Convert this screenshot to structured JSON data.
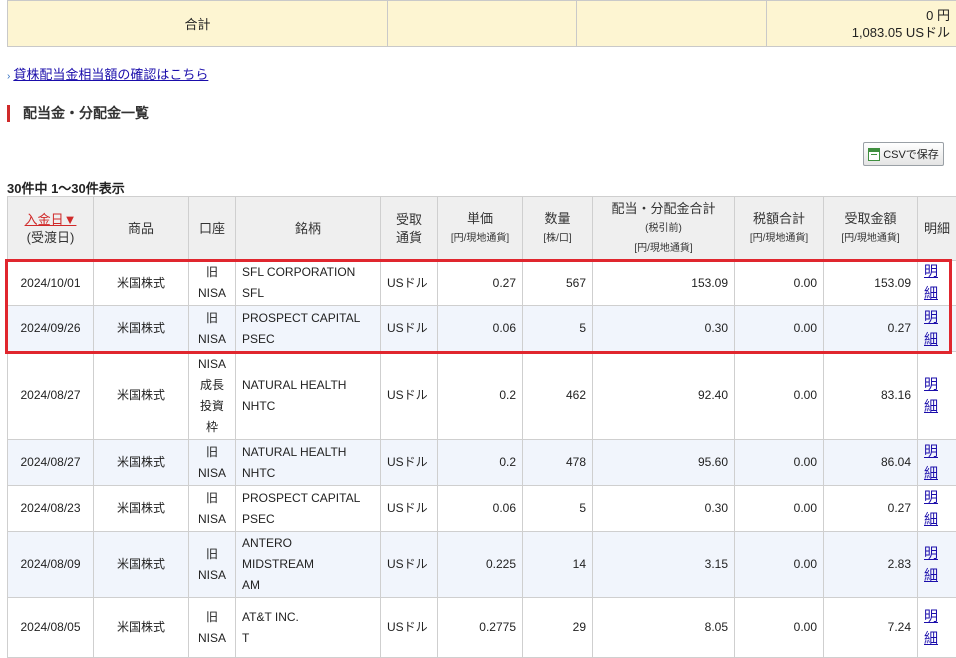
{
  "summary": {
    "total_label": "合計",
    "total_jpy": "0 円",
    "total_usd": "1,083.05 USドル"
  },
  "links": {
    "lending_dividend": "貸株配当金相当額の確認はこちら"
  },
  "section": {
    "title": "配当金・分配金一覧"
  },
  "toolbar": {
    "csv_label": "CSVで保存"
  },
  "list": {
    "count_label": "30件中 1～30件表示"
  },
  "table": {
    "headers": {
      "date": "入金日▼",
      "date_sub": "(受渡日)",
      "product": "商品",
      "account": "口座",
      "security": "銘柄",
      "currency_1": "受取",
      "currency_2": "通貨",
      "unit_price": "単価",
      "unit_price_sub": "[円/現地通貨]",
      "quantity": "数量",
      "quantity_sub": "[株/口]",
      "dividend_total": "配当・分配金合計",
      "dividend_total_sub1": "(税引前)",
      "dividend_total_sub2": "[円/現地通貨]",
      "tax_total": "税額合計",
      "tax_total_sub": "[円/現地通貨]",
      "received": "受取金額",
      "received_sub": "[円/現地通貨]",
      "detail": "明細"
    },
    "rows": [
      {
        "date": "2024/10/01",
        "product": "米国株式",
        "account": [
          "旧",
          "NISA"
        ],
        "security": [
          "SFL CORPORATION",
          "SFL"
        ],
        "currency": "USドル",
        "unit_price": "0.27",
        "quantity": "567",
        "dividend": "153.09",
        "tax": "0.00",
        "received": "153.09",
        "detail": "明細"
      },
      {
        "date": "2024/09/26",
        "product": "米国株式",
        "account": [
          "旧",
          "NISA"
        ],
        "security": [
          "PROSPECT CAPITAL",
          "PSEC"
        ],
        "currency": "USドル",
        "unit_price": "0.06",
        "quantity": "5",
        "dividend": "0.30",
        "tax": "0.00",
        "received": "0.27",
        "detail": "明細"
      },
      {
        "date": "2024/08/27",
        "product": "米国株式",
        "account": [
          "NISA",
          "成長",
          "投資",
          "枠"
        ],
        "security": [
          "NATURAL HEALTH",
          "NHTC"
        ],
        "currency": "USドル",
        "unit_price": "0.2",
        "quantity": "462",
        "dividend": "92.40",
        "tax": "0.00",
        "received": "83.16",
        "detail": "明細"
      },
      {
        "date": "2024/08/27",
        "product": "米国株式",
        "account": [
          "旧",
          "NISA"
        ],
        "security": [
          "NATURAL HEALTH",
          "NHTC"
        ],
        "currency": "USドル",
        "unit_price": "0.2",
        "quantity": "478",
        "dividend": "95.60",
        "tax": "0.00",
        "received": "86.04",
        "detail": "明細"
      },
      {
        "date": "2024/08/23",
        "product": "米国株式",
        "account": [
          "旧",
          "NISA"
        ],
        "security": [
          "PROSPECT CAPITAL",
          "PSEC"
        ],
        "currency": "USドル",
        "unit_price": "0.06",
        "quantity": "5",
        "dividend": "0.30",
        "tax": "0.00",
        "received": "0.27",
        "detail": "明細"
      },
      {
        "date": "2024/08/09",
        "product": "米国株式",
        "account": [
          "旧",
          "NISA"
        ],
        "security": [
          "ANTERO",
          "MIDSTREAM",
          "AM"
        ],
        "currency": "USドル",
        "unit_price": "0.225",
        "quantity": "14",
        "dividend": "3.15",
        "tax": "0.00",
        "received": "2.83",
        "detail": "明細"
      },
      {
        "date": "2024/08/05",
        "product": "米国株式",
        "account": [
          "旧",
          "NISA"
        ],
        "security": [
          "AT&T INC.",
          "T"
        ],
        "currency": "USドル",
        "unit_price": "0.2775",
        "quantity": "29",
        "dividend": "8.05",
        "tax": "0.00",
        "received": "7.24",
        "detail": "明細"
      }
    ]
  },
  "colors": {
    "total_bg": "#fdf5d2",
    "header_bg": "#efefef",
    "alt_row_bg": "#f1f5fc",
    "accent_red": "#e0262e",
    "link_blue": "#1a0dab"
  }
}
